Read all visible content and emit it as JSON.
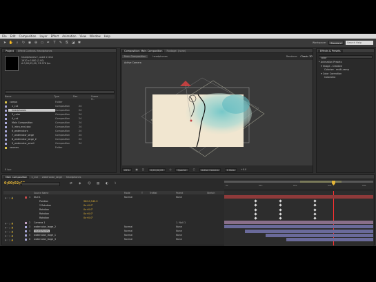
{
  "menu": [
    "File",
    "Edit",
    "Composition",
    "Layer",
    "Effect",
    "Animation",
    "View",
    "Window",
    "Help"
  ],
  "toolbar": {
    "tools": [
      "arrow-tool",
      "hand-tool",
      "zoom-tool",
      "rotate-tool",
      "camera-tool",
      "pan-tool",
      "rect-tool",
      "pen-tool",
      "text-tool",
      "brush-tool",
      "clone-tool",
      "eraser-tool",
      "puppet-tool"
    ],
    "workspace_label": "Workspace:",
    "workspace_value": "Standard",
    "search_placeholder": "Search Help"
  },
  "project": {
    "tabs": [
      "Project",
      "Effect Controls: headphones"
    ],
    "selected_name": "headphones ▾, used 1 time",
    "info_lines": [
      "1920 x 1080 (1.00)",
      "Δ 0;00;05;00, 23.976 fps"
    ],
    "columns": [
      "Name",
      "Type",
      "Size",
      "Frame R..."
    ],
    "items": [
      {
        "name": "comps",
        "type": "Folder",
        "fps": "",
        "color": "#d8c24a",
        "selected": false
      },
      {
        "name": "1_cut",
        "type": "Composition",
        "fps": "24",
        "color": "#a8a8d8",
        "selected": false
      },
      {
        "name": "headphones",
        "type": "Composition",
        "fps": "24",
        "color": "#a8a8d8",
        "selected": true
      },
      {
        "name": "3_color",
        "type": "Composition",
        "fps": "24",
        "color": "#a8a8d8",
        "selected": false
      },
      {
        "name": "4_cut",
        "type": "Composition",
        "fps": "24",
        "color": "#a8a8d8",
        "selected": false
      },
      {
        "name": "Main Composition",
        "type": "Composition",
        "fps": "24",
        "color": "#a8a8d8",
        "selected": false
      },
      {
        "name": "5_intro_end_sba",
        "type": "Composition",
        "fps": "24",
        "color": "#a8a8d8",
        "selected": false
      },
      {
        "name": "6_watercolors",
        "type": "Composition",
        "fps": "24",
        "color": "#a8a8d8",
        "selected": false
      },
      {
        "name": "7_watercolor_large",
        "type": "Composition",
        "fps": "24",
        "color": "#a8a8d8",
        "selected": false
      },
      {
        "name": "8_watercolor_large_2",
        "type": "Composition",
        "fps": "24",
        "color": "#a8a8d8",
        "selected": false
      },
      {
        "name": "9_watercolor_small",
        "type": "Composition",
        "fps": "24",
        "color": "#a8a8d8",
        "selected": false
      },
      {
        "name": "sources",
        "type": "Folder",
        "fps": "",
        "color": "#d8c24a",
        "selected": false
      }
    ],
    "footer": "8 bpc"
  },
  "composition": {
    "tabs": [
      "Composition: Main Composition",
      "Footage: (none)"
    ],
    "sub_tabs": [
      "Main Composition",
      "headphones"
    ],
    "renderer_label": "Renderer:",
    "renderer_value": "Classic 3D",
    "camera_label": "Active Camera",
    "controls": [
      "25%",
      "0;00;02;09",
      "Quarter",
      "Active Camera",
      "1 View",
      "+0.0"
    ]
  },
  "effects": {
    "tabs": [
      "Effects & Presets"
    ],
    "search_value": "color",
    "items": [
      "* Animation Presets",
      "▾ Image - Creative",
      "Colorize - multi-ramp",
      "▾ Color Correction",
      "Colorama"
    ]
  },
  "timeline": {
    "tabs": [
      "Main Composition",
      "1_cut",
      "watercolor_large",
      "headphones"
    ],
    "timecode": "0;00;02;09",
    "columns": [
      "Source Name",
      "Mode",
      "T",
      "TrkMat",
      "Parent",
      "Stretch"
    ],
    "ruler_labels": [
      "0s",
      "01s",
      "02s",
      "03s",
      "04s"
    ],
    "layers": [
      {
        "num": "1",
        "name": "Null 1",
        "color": "#c84a4a",
        "val": "",
        "mode": "Normal",
        "parent": "None",
        "highlight": false
      },
      {
        "num": "",
        "name": "Position",
        "color": "",
        "val": "960.0,540.0",
        "mode": "",
        "parent": "",
        "highlight": false
      },
      {
        "num": "",
        "name": "Y Rotation",
        "color": "",
        "val": "0x+0.0°",
        "mode": "",
        "parent": "",
        "highlight": false
      },
      {
        "num": "",
        "name": "Rotation",
        "color": "",
        "val": "0x+0.0°",
        "mode": "",
        "parent": "",
        "highlight": false
      },
      {
        "num": "",
        "name": "Rotation",
        "color": "",
        "val": "0x+0.0°",
        "mode": "",
        "parent": "",
        "highlight": false
      },
      {
        "num": "",
        "name": "Rotation",
        "color": "",
        "val": "0x+0.0°",
        "mode": "",
        "parent": "",
        "highlight": false
      },
      {
        "num": "2",
        "name": "Camera 1",
        "color": "#c0a0c0",
        "val": "",
        "mode": "",
        "parent": "1. Null 1",
        "highlight": false
      },
      {
        "num": "3",
        "name": "watercolor_large_2",
        "color": "#a8a8d8",
        "val": "",
        "mode": "Normal",
        "parent": "None",
        "highlight": false
      },
      {
        "num": "4",
        "name": "headphones",
        "color": "#a8a8d8",
        "val": "",
        "mode": "Normal",
        "parent": "None",
        "highlight": true
      },
      {
        "num": "5",
        "name": "watercolor_large_1",
        "color": "#a8a8d8",
        "val": "",
        "mode": "Normal",
        "parent": "None",
        "highlight": false
      },
      {
        "num": "6",
        "name": "watercolor_large_3",
        "color": "#a8a8d8",
        "val": "",
        "mode": "Normal",
        "parent": "None",
        "highlight": false
      }
    ],
    "stretch_values": [
      "100.0%",
      "100.0%",
      "100.0%",
      "100.0%",
      "100.0%"
    ]
  }
}
